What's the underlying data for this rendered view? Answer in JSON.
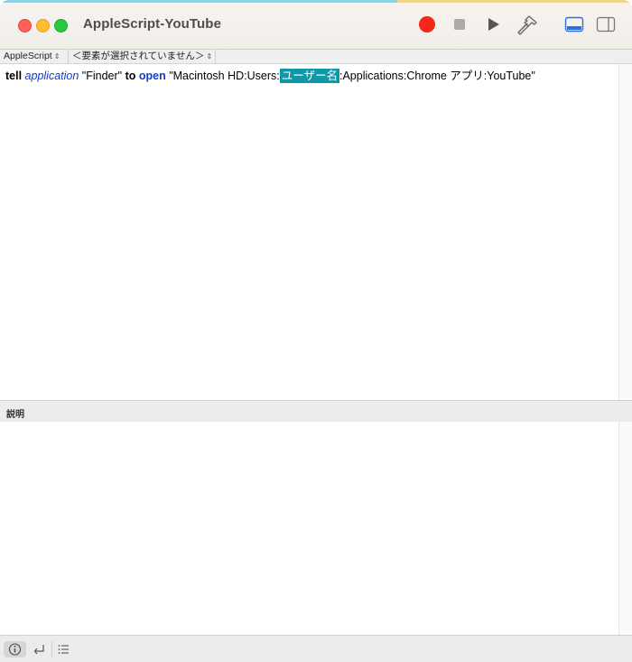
{
  "window": {
    "title": "AppleScript-YouTube"
  },
  "toolbar": {
    "record": {
      "icon": "record-icon",
      "color": "#f4271a"
    },
    "stop": {
      "icon": "stop-icon"
    },
    "run": {
      "icon": "run-icon"
    },
    "compile": {
      "icon": "hammer-icon"
    },
    "view_buttons": [
      {
        "icon": "bottom-pane-icon",
        "active": true,
        "color": "#2e6fe4"
      },
      {
        "icon": "side-pane-icon",
        "active": false
      }
    ]
  },
  "navbar": {
    "language": "AppleScript",
    "element": "＜要素が選択されていません＞"
  },
  "editor": {
    "code": {
      "tell": "tell",
      "application": "application",
      "finder": " \"Finder\" ",
      "to": "to",
      "open": "open",
      "path_before": " \"Macintosh HD:Users:",
      "selected": "ユーザー名",
      "path_after": ":Applications:Chrome アプリ:YouTube\""
    },
    "selection_color": "#0e98a8"
  },
  "description_pane": {
    "title": "説明"
  },
  "bottombar": {
    "buttons": [
      {
        "icon": "info-icon",
        "active": true
      },
      {
        "icon": "reply-arrow-icon",
        "active": false
      },
      {
        "icon": "list-icon",
        "active": false
      }
    ]
  }
}
